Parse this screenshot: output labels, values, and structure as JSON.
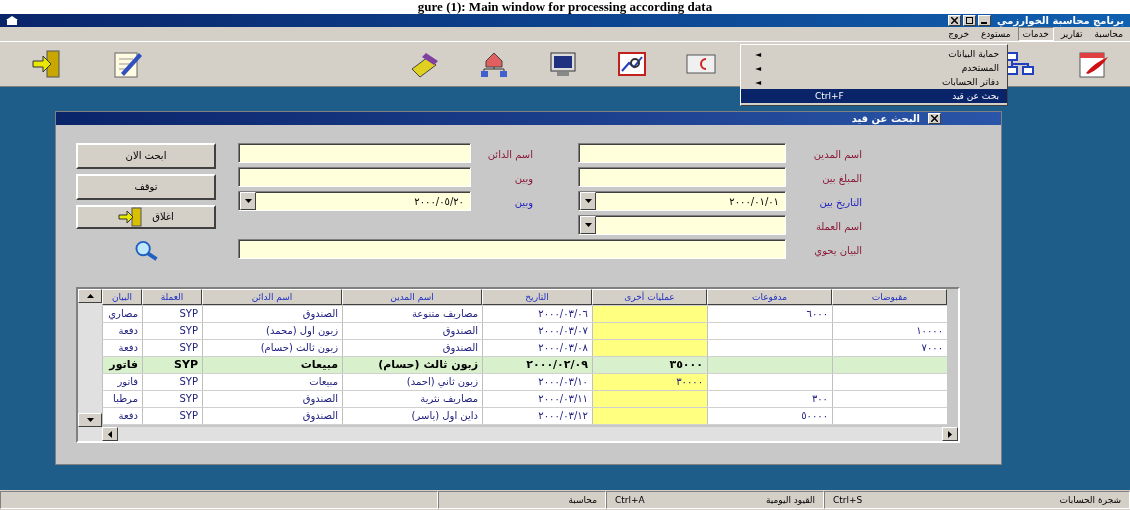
{
  "caption": "gure (1): Main window for processing according data",
  "window": {
    "title": "برنامج محاسبة الخوارزمي"
  },
  "menu": [
    {
      "label": "محاسبة",
      "selected": false
    },
    {
      "label": "تقارير",
      "selected": false
    },
    {
      "label": "خدمات",
      "selected": true
    },
    {
      "label": "مستودع",
      "selected": false
    },
    {
      "label": "خروج",
      "selected": false
    }
  ],
  "dropdown": [
    {
      "label": "حماية البيانات",
      "submenu_mark": "◄",
      "selected": false
    },
    {
      "label": "المستخدم",
      "submenu_mark": "◄",
      "selected": false
    },
    {
      "label": "دفاتر الحسابات",
      "submenu_mark": "◄",
      "selected": false
    },
    {
      "label": "بحث عن قيد",
      "shortcut": "Ctrl+F",
      "selected": true
    }
  ],
  "dialog": {
    "title": "البحث عن قيد",
    "rows": [
      {
        "right": {
          "label": "اسم المدين",
          "color": "#8b1a3a",
          "kind": "text"
        },
        "left": {
          "label": "اسم الدائن",
          "color": "#8b1a3a",
          "kind": "text"
        }
      },
      {
        "right": {
          "label": "المبلغ بين",
          "color": "#8b1a3a",
          "kind": "text"
        },
        "left": {
          "label": "وبين",
          "color": "#8b1a3a",
          "kind": "text"
        }
      },
      {
        "right": {
          "label": "التاريخ بين",
          "color": "#2020c0",
          "kind": "combo",
          "value": "٢٠٠٠/٠١/٠١"
        },
        "left": {
          "label": "وبين",
          "color": "#2020c0",
          "kind": "combo",
          "value": "٢٠٠٠/٠٥/٢٠"
        }
      },
      {
        "right": {
          "label": "اسم العملة",
          "color": "#8b1a3a",
          "kind": "combo"
        }
      },
      {
        "wide": {
          "label": "البيان يحوي",
          "color": "#8b1a3a",
          "kind": "text"
        }
      }
    ],
    "buttons": [
      {
        "label": "ابحث الان",
        "kind": "plain"
      },
      {
        "label": "توقف",
        "kind": "plain"
      },
      {
        "label": "اغلاق",
        "kind": "door"
      }
    ]
  },
  "table": {
    "columns": [
      {
        "label": "مقبوضات",
        "tinted": false
      },
      {
        "label": "مدفوعات",
        "tinted": false
      },
      {
        "label": "عمليات أخرى",
        "tinted": true
      },
      {
        "label": "التاريخ",
        "tinted": false
      },
      {
        "label": "اسم المدين",
        "tinted": false
      },
      {
        "label": "اسم الدائن",
        "tinted": false
      },
      {
        "label": "العملة",
        "tinted": false
      },
      {
        "label": "البيان",
        "tinted": false
      }
    ],
    "rows": [
      {
        "cells": [
          "",
          "٦٠٠٠",
          "",
          "٢٠٠٠/٠٣/٠٦",
          "مصاريف متنوعة",
          "الصندوق",
          "SYP",
          "مصاري"
        ],
        "selected": false
      },
      {
        "cells": [
          "١٠٠٠٠",
          "",
          "",
          "٢٠٠٠/٠٣/٠٧",
          "الصندوق",
          "زبون اول (محمد)",
          "SYP",
          "دفعة"
        ],
        "selected": false
      },
      {
        "cells": [
          "٧٠٠٠",
          "",
          "",
          "٢٠٠٠/٠٣/٠٨",
          "الصندوق",
          "زبون ثالث (حسام)",
          "SYP",
          "دفعة"
        ],
        "selected": false
      },
      {
        "cells": [
          "",
          "",
          "٣٥٠٠٠",
          "٢٠٠٠/٠٢/٠٩",
          "زبون ثالث (حسام)",
          "مبيعات",
          "SYP",
          "فاتور"
        ],
        "selected": true
      },
      {
        "cells": [
          "",
          "",
          "٣٠٠٠٠",
          "٢٠٠٠/٠٣/١٠",
          "زبون ثاني (احمد)",
          "مبيعات",
          "SYP",
          "فاتور"
        ],
        "selected": false
      },
      {
        "cells": [
          "",
          "٣٠٠",
          "",
          "٢٠٠٠/٠٣/١١",
          "مصاريف نثرية",
          "الصندوق",
          "SYP",
          "مرطبا"
        ],
        "selected": false
      },
      {
        "cells": [
          "",
          "٥٠٠٠٠",
          "",
          "٢٠٠٠/٠٣/١٢",
          "داين اول (ياسر)",
          "الصندوق",
          "SYP",
          "دفعة"
        ],
        "selected": false
      }
    ]
  },
  "status_bar": [
    {
      "label": "شجرة الحسابات",
      "shortcut": "Ctrl+S"
    },
    {
      "label": "القيود اليومية",
      "shortcut": "Ctrl+A"
    },
    {
      "label": "محاسبة"
    }
  ]
}
